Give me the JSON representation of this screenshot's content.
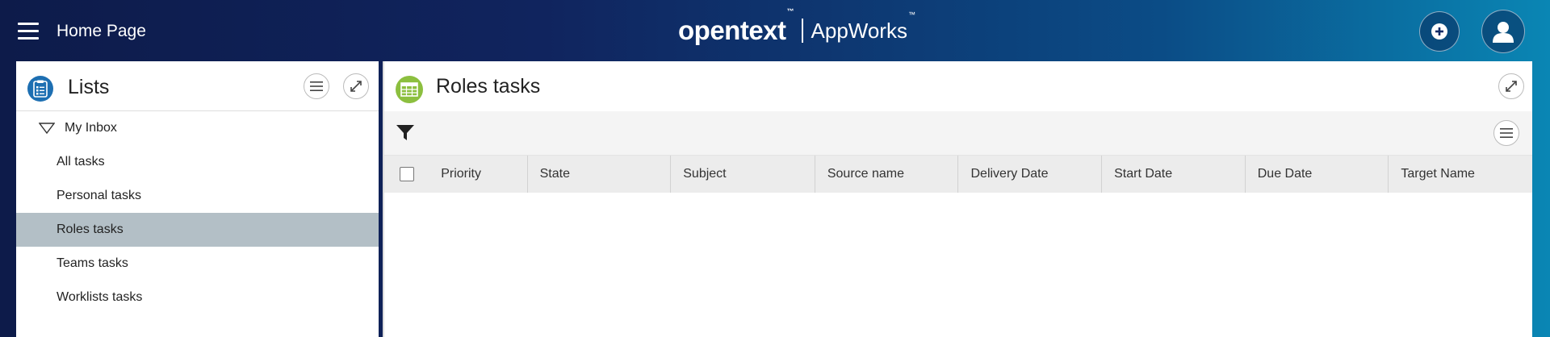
{
  "header": {
    "page_title": "Home Page",
    "brand_name": "opentext",
    "brand_tm": "™",
    "product_name": "AppWorks",
    "product_tm": "™",
    "icons": {
      "menu": "hamburger-menu-icon",
      "add": "plus-circle-icon",
      "user": "user-avatar-icon"
    }
  },
  "lists_panel": {
    "title": "Lists",
    "icons": {
      "header": "clipboard-list-icon",
      "menu": "menu-lines-icon",
      "maximize": "expand-arrow-icon",
      "tree": "triangle-down-icon"
    },
    "tree": {
      "root": "My Inbox",
      "items": [
        {
          "label": "All tasks",
          "selected": false
        },
        {
          "label": "Personal tasks",
          "selected": false
        },
        {
          "label": "Roles tasks",
          "selected": true
        },
        {
          "label": "Teams tasks",
          "selected": false
        },
        {
          "label": "Worklists tasks",
          "selected": false
        }
      ]
    }
  },
  "task_panel": {
    "title": "Roles tasks",
    "icons": {
      "header": "table-grid-icon",
      "maximize": "expand-arrow-icon",
      "filter": "filter-funnel-icon",
      "menu": "menu-lines-icon"
    },
    "columns": [
      "Priority",
      "State",
      "Subject",
      "Source name",
      "Delivery Date",
      "Start Date",
      "Due Date",
      "Target Name"
    ],
    "rows": []
  },
  "colors": {
    "header_gradient_start": "#0d1b4a",
    "header_gradient_end": "#0a86b4",
    "selected_row": "#b3bfc6",
    "lists_icon_bg": "#1d6fb2",
    "roles_icon_bg": "#8cbf3f"
  }
}
